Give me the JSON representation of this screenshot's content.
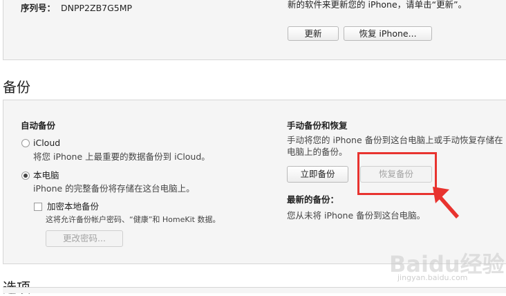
{
  "software": {
    "serial_label": "序列号：",
    "serial_value": "DNPP2ZB7G5MP",
    "update_text": "新的软件来更新您的 iPhone，请单击“更新”。",
    "update_button": "更新",
    "restore_iphone_button": "恢复 iPhone..."
  },
  "backup": {
    "heading": "备份",
    "auto": {
      "title": "自动备份",
      "icloud_label": "iCloud",
      "icloud_desc": "将您 iPhone 上最重要的数据备份到 iCloud。",
      "icloud_selected": false,
      "local_label": "本电脑",
      "local_desc": "iPhone 的完整备份将存储在这台电脑上。",
      "local_selected": true,
      "encrypt_label": "加密本地备份",
      "encrypt_checked": false,
      "encrypt_desc": "这将允许备份帐户密码、“健康”和 HomeKit 数据。",
      "change_password_button": "更改密码..."
    },
    "manual": {
      "title": "手动备份和恢复",
      "desc_line1": "手动将您的 iPhone 备份到这台电脑上或手动恢复存储在",
      "desc_line2": "电脑上的备份。",
      "backup_now_button": "立即备份",
      "restore_backup_button": "恢复备份",
      "latest_title": "最新的备份：",
      "latest_value": "您从未将 iPhone 备份到这台电脑。"
    }
  },
  "options": {
    "heading": "选项"
  },
  "annotation": {
    "color": "#e8332f"
  },
  "watermark": {
    "logo": "Baidu经验",
    "url": "jingyan.baidu.com"
  }
}
